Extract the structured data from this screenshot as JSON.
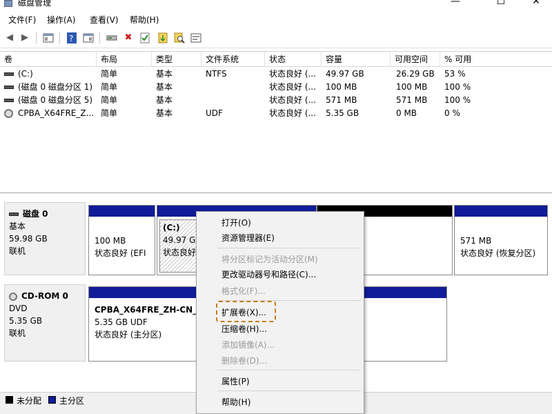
{
  "window": {
    "title": "磁盘管理",
    "minimize": "—",
    "maximize": "☐",
    "close": "✕"
  },
  "menu": [
    "文件(F)",
    "操作(A)",
    "查看(V)",
    "帮助(H)"
  ],
  "columns": [
    "卷",
    "布局",
    "类型",
    "文件系统",
    "状态",
    "容量",
    "可用空间",
    "% 可用"
  ],
  "volumes": [
    {
      "name": "(C:)",
      "layout": "简单",
      "type": "基本",
      "fs": "NTFS",
      "status": "状态良好 (...",
      "capacity": "49.97 GB",
      "free": "26.29 GB",
      "pct": "53 %"
    },
    {
      "name": "(磁盘 0 磁盘分区 1)",
      "layout": "简单",
      "type": "基本",
      "fs": "",
      "status": "状态良好 (...",
      "capacity": "100 MB",
      "free": "100 MB",
      "pct": "100 %"
    },
    {
      "name": "(磁盘 0 磁盘分区 5)",
      "layout": "简单",
      "type": "基本",
      "fs": "",
      "status": "状态良好 (...",
      "capacity": "571 MB",
      "free": "571 MB",
      "pct": "100 %"
    },
    {
      "name": "CPBA_X64FRE_Z...",
      "layout": "简单",
      "type": "基本",
      "fs": "UDF",
      "status": "状态良好 (...",
      "capacity": "5.35 GB",
      "free": "0 MB",
      "pct": "0 %"
    }
  ],
  "disk0": {
    "name": "磁盘 0",
    "type": "基本",
    "size": "59.98 GB",
    "state": "联机",
    "partitions": [
      {
        "size": "100 MB",
        "status": "状态良好 (EFI"
      },
      {
        "name": "(C:)",
        "size": "49.97 G",
        "status": "状态良好"
      },
      {
        "size": "571 MB",
        "status": "状态良好 (恢复分区)"
      }
    ]
  },
  "cdrom0": {
    "name": "CD-ROM 0",
    "type": "DVD",
    "size": "5.35 GB",
    "state": "联机",
    "partition": {
      "name": "CPBA_X64FRE_ZH-CN_D",
      "size": "5.35 GB UDF",
      "status": "状态良好 (主分区)"
    }
  },
  "legend": {
    "unallocated": "未分配",
    "primary": "主分区"
  },
  "context_menu": {
    "open": "打开(O)",
    "explorer": "资源管理器(E)",
    "mark_active": "将分区标记为活动分区(M)",
    "change_letter": "更改驱动器号和路径(C)...",
    "format": "格式化(F)...",
    "extend": "扩展卷(X)...",
    "shrink": "压缩卷(H)...",
    "add_mirror": "添加镜像(A)...",
    "delete": "删除卷(D)...",
    "properties": "属性(P)",
    "help": "帮助(H)"
  },
  "colors": {
    "primary_partition": "#101c98",
    "unallocated": "#000000",
    "highlight": "#c87a1a"
  }
}
